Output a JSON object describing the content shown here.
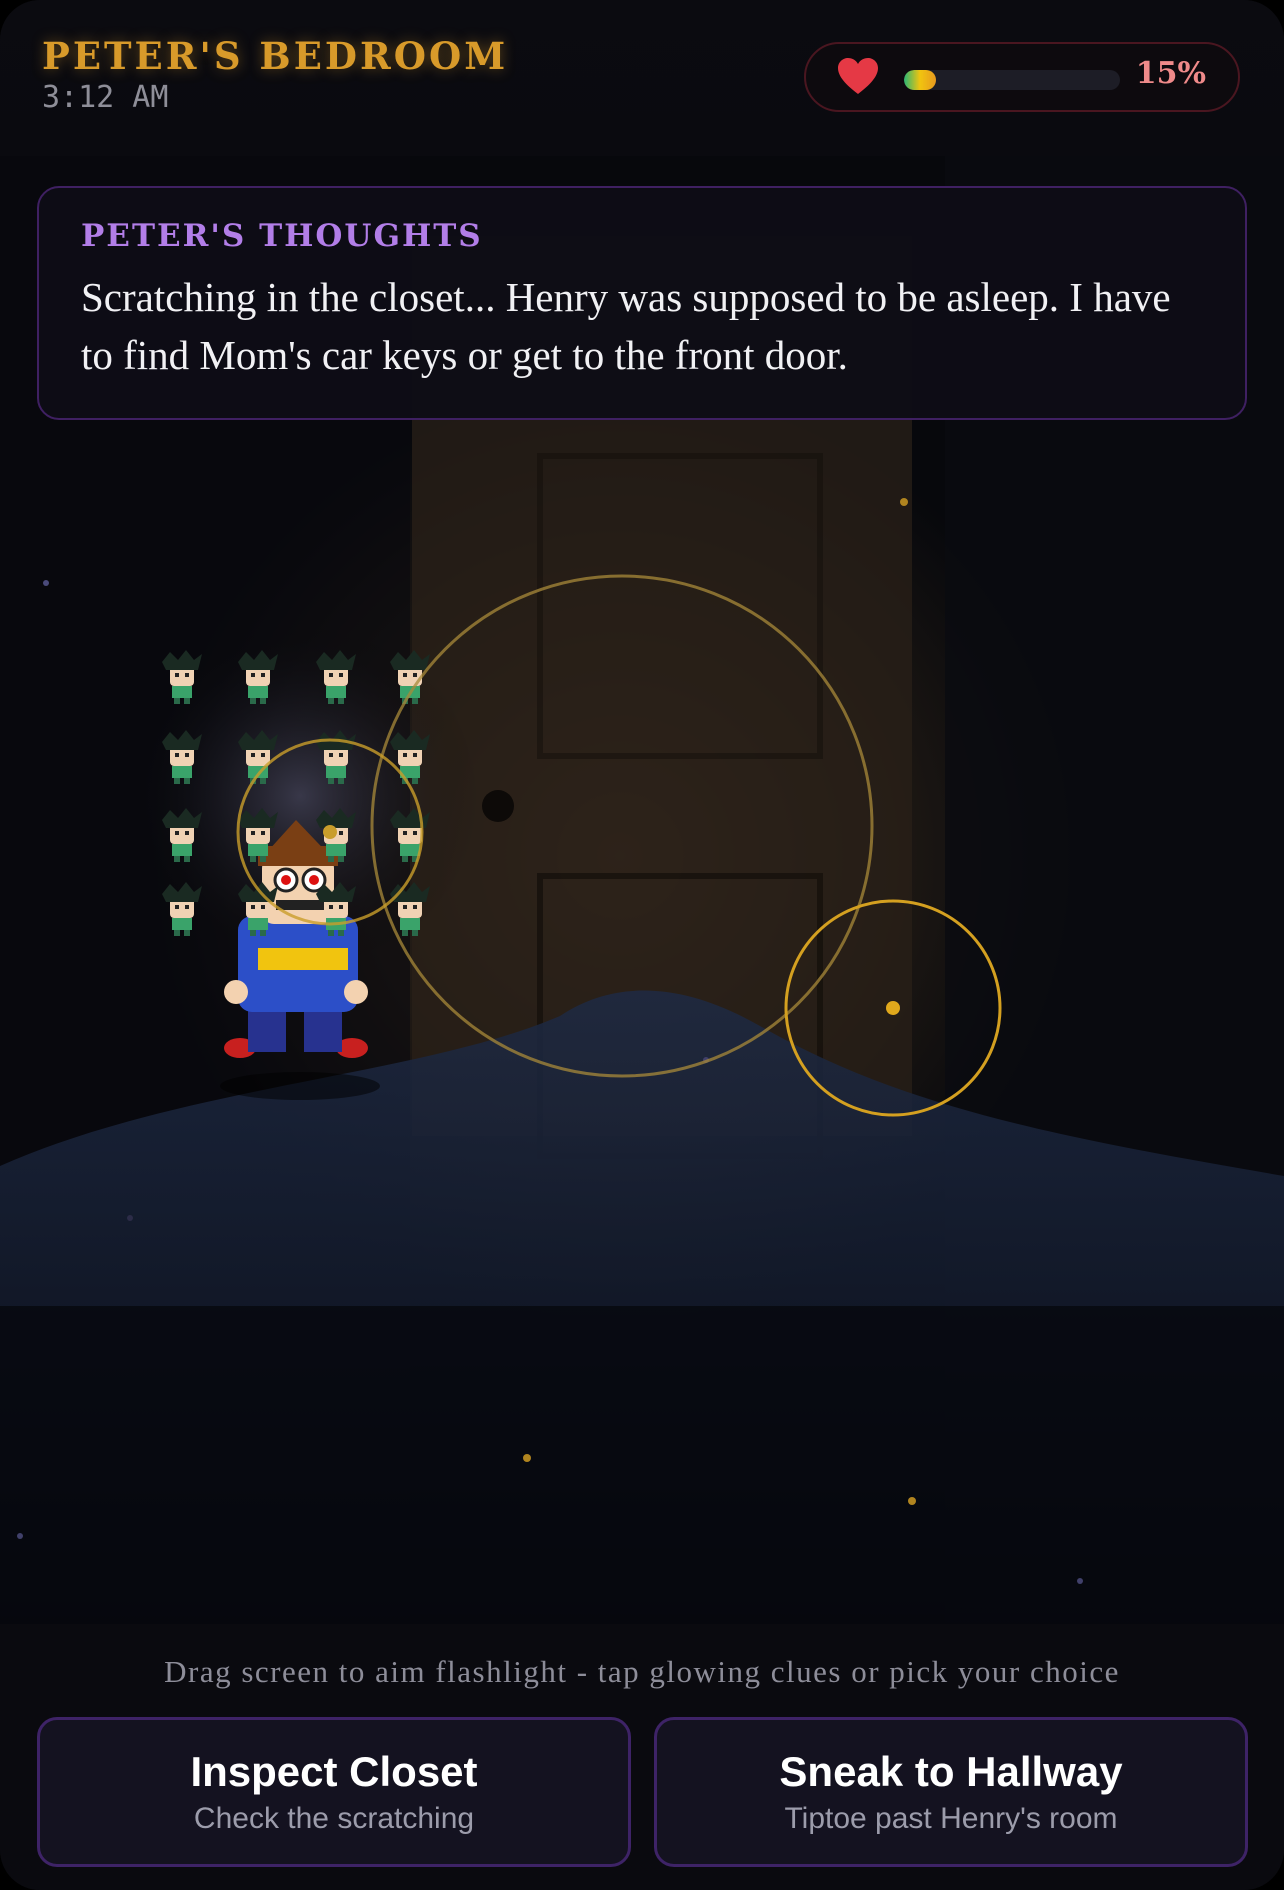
{
  "header": {
    "location": "PETER'S BEDROOM",
    "time": "3:12 AM",
    "health_percent_label": "15%",
    "health_fraction": 0.15,
    "health_icon": "heart-icon"
  },
  "thoughts": {
    "label": "PETER'S THOUGHTS",
    "text": "Scratching in the closet... Henry was supposed to be asleep. I have to find Mom's car keys or get to the front door."
  },
  "hint": "Drag screen to aim flashlight - tap glowing clues or pick your choice",
  "choices": [
    {
      "title": "Inspect Closet",
      "subtitle": "Check the scratching"
    },
    {
      "title": "Sneak to Hallway",
      "subtitle": "Tiptoe past Henry's room"
    }
  ],
  "colors": {
    "accent_gold": "#d89a2a",
    "thoughts_purple": "#b27ee8",
    "health_red": "#e53945",
    "panel_border": "#3f2062"
  }
}
